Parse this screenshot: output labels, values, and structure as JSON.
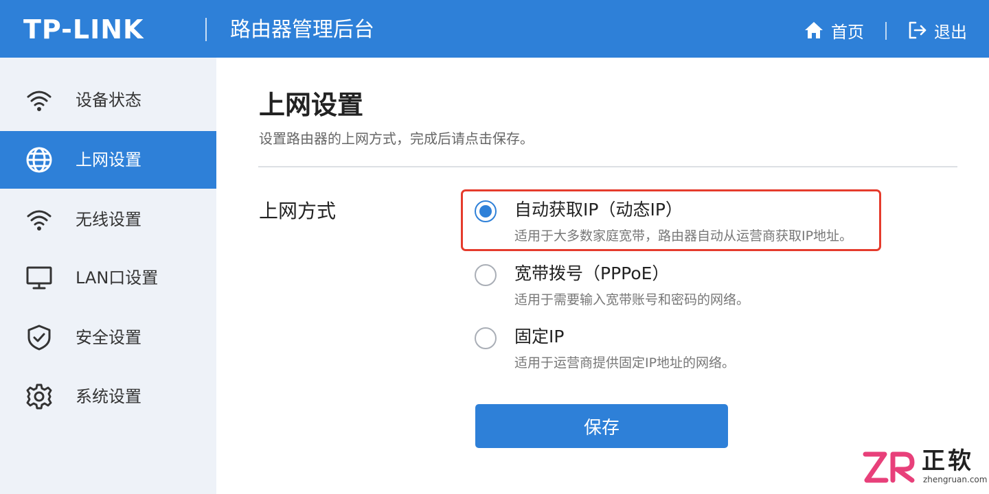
{
  "header": {
    "logo": "TP-LINK",
    "app_title": "路由器管理后台",
    "home_label": "首页",
    "logout_label": "退出",
    "bg_color": "#2e80d8"
  },
  "sidebar": {
    "items": [
      {
        "label": "设备状态",
        "icon": "wifi-icon",
        "active": false
      },
      {
        "label": "上网设置",
        "icon": "globe-icon",
        "active": true
      },
      {
        "label": "无线设置",
        "icon": "wifi-icon",
        "active": false
      },
      {
        "label": "LAN口设置",
        "icon": "monitor-icon",
        "active": false
      },
      {
        "label": "安全设置",
        "icon": "shield-check-icon",
        "active": false
      },
      {
        "label": "系统设置",
        "icon": "gear-icon",
        "active": false
      }
    ]
  },
  "main": {
    "title": "上网设置",
    "description": "设置路由器的上网方式，完成后请点击保存。",
    "field_label": "上网方式",
    "options": [
      {
        "title": "自动获取IP（动态IP）",
        "desc": "适用于大多数家庭宽带，路由器自动从运营商获取IP地址。",
        "selected": true
      },
      {
        "title": "宽带拨号（PPPoE）",
        "desc": "适用于需要输入宽带账号和密码的网络。",
        "selected": false
      },
      {
        "title": "固定IP",
        "desc": "适用于运营商提供固定IP地址的网络。",
        "selected": false
      }
    ],
    "save_label": "保存",
    "highlight_color": "#e53b2c"
  },
  "watermark": {
    "text": "正软",
    "url": "zhengruan.com"
  }
}
